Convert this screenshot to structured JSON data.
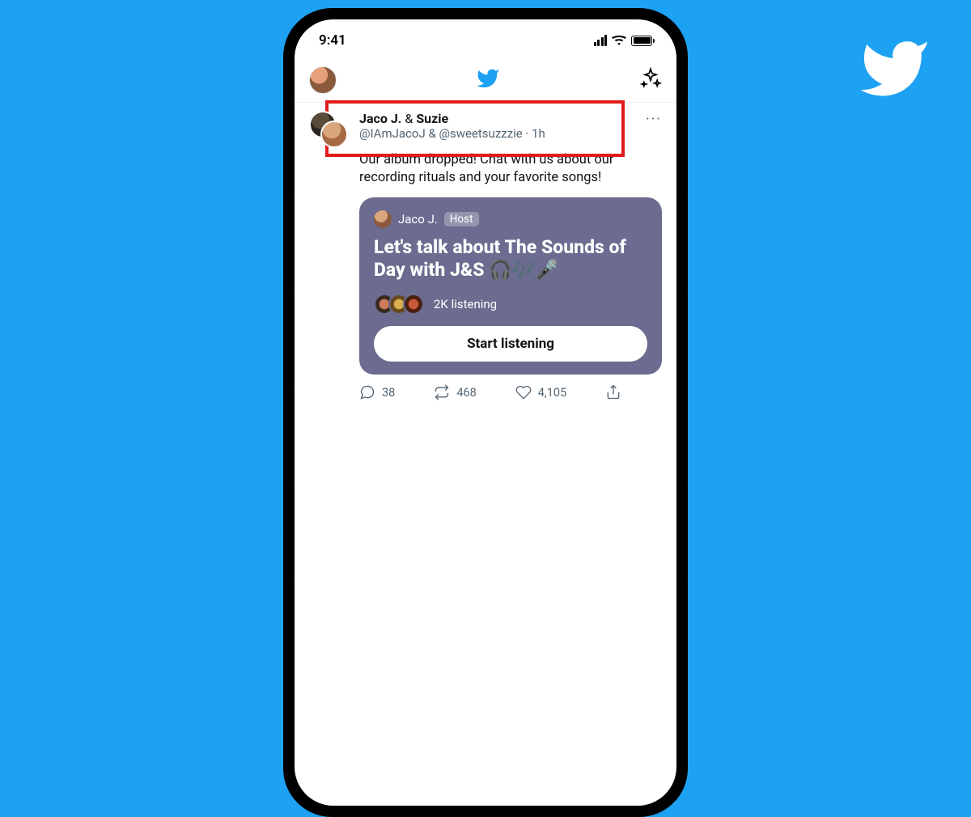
{
  "status": {
    "time": "9:41"
  },
  "tweet": {
    "author1_name": "Jaco J.",
    "amp": " & ",
    "author2_name": "Suzie",
    "handles": "@IAmJacoJ & @sweetsuzzzie · 1h",
    "text": "Our album dropped! Chat with us about our recording rituals and your favorite songs!",
    "more": "···"
  },
  "space": {
    "host_name": "Jaco J.",
    "host_badge": "Host",
    "title": "Let's talk about The Sounds of Day with J&S 🎧🎶🎤",
    "listening": "2K listening",
    "button": "Start listening"
  },
  "actions": {
    "replies": "38",
    "retweets": "468",
    "likes": "4,105"
  }
}
